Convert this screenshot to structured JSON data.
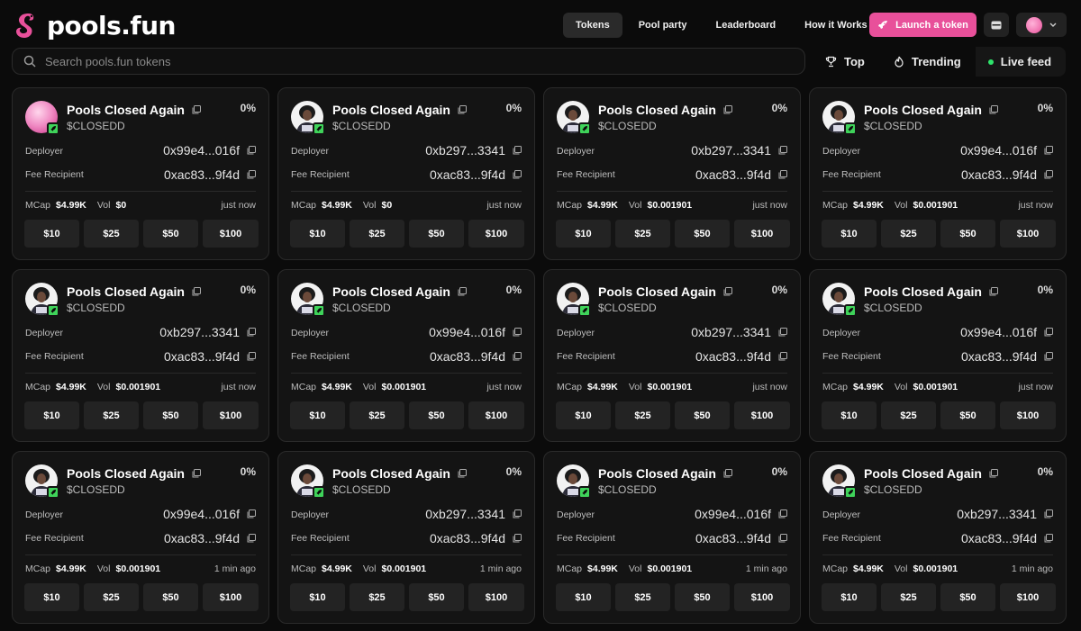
{
  "brand": {
    "name": "pools.fun"
  },
  "nav": {
    "items": [
      {
        "label": "Tokens",
        "active": true
      },
      {
        "label": "Pool party",
        "active": false
      },
      {
        "label": "Leaderboard",
        "active": false
      },
      {
        "label": "How it Works",
        "active": false
      }
    ],
    "launch_label": "Launch a token"
  },
  "search": {
    "placeholder": "Search pools.fun tokens"
  },
  "filters": [
    {
      "label": "Top",
      "icon": "trophy-icon"
    },
    {
      "label": "Trending",
      "icon": "flame-icon"
    },
    {
      "label": "Live feed",
      "icon": "live-dot-icon"
    }
  ],
  "colors": {
    "accent": "#e8509a",
    "live": "#2ee36b",
    "badge": "#3fd35a"
  },
  "labels": {
    "deployer": "Deployer",
    "fee_recipient": "Fee Recipient",
    "mcap": "MCap",
    "vol": "Vol"
  },
  "amounts": [
    "$10",
    "$25",
    "$50",
    "$100"
  ],
  "cards": [
    {
      "name": "Pools Closed Again",
      "ticker": "$CLOSEDD",
      "pct": "0%",
      "deployer": "0x99e4...016f",
      "fee": "0xac83...9f4d",
      "mcap": "$4.99K",
      "vol": "$0",
      "time": "just now",
      "avatar": "pink"
    },
    {
      "name": "Pools Closed Again",
      "ticker": "$CLOSEDD",
      "pct": "0%",
      "deployer": "0xb297...3341",
      "fee": "0xac83...9f4d",
      "mcap": "$4.99K",
      "vol": "$0",
      "time": "just now",
      "avatar": "person"
    },
    {
      "name": "Pools Closed Again",
      "ticker": "$CLOSEDD",
      "pct": "0%",
      "deployer": "0xb297...3341",
      "fee": "0xac83...9f4d",
      "mcap": "$4.99K",
      "vol": "$0.001901",
      "time": "just now",
      "avatar": "person"
    },
    {
      "name": "Pools Closed Again",
      "ticker": "$CLOSEDD",
      "pct": "0%",
      "deployer": "0x99e4...016f",
      "fee": "0xac83...9f4d",
      "mcap": "$4.99K",
      "vol": "$0.001901",
      "time": "just now",
      "avatar": "person"
    },
    {
      "name": "Pools Closed Again",
      "ticker": "$CLOSEDD",
      "pct": "0%",
      "deployer": "0xb297...3341",
      "fee": "0xac83...9f4d",
      "mcap": "$4.99K",
      "vol": "$0.001901",
      "time": "just now",
      "avatar": "person"
    },
    {
      "name": "Pools Closed Again",
      "ticker": "$CLOSEDD",
      "pct": "0%",
      "deployer": "0x99e4...016f",
      "fee": "0xac83...9f4d",
      "mcap": "$4.99K",
      "vol": "$0.001901",
      "time": "just now",
      "avatar": "person"
    },
    {
      "name": "Pools Closed Again",
      "ticker": "$CLOSEDD",
      "pct": "0%",
      "deployer": "0xb297...3341",
      "fee": "0xac83...9f4d",
      "mcap": "$4.99K",
      "vol": "$0.001901",
      "time": "just now",
      "avatar": "person"
    },
    {
      "name": "Pools Closed Again",
      "ticker": "$CLOSEDD",
      "pct": "0%",
      "deployer": "0x99e4...016f",
      "fee": "0xac83...9f4d",
      "mcap": "$4.99K",
      "vol": "$0.001901",
      "time": "just now",
      "avatar": "person"
    },
    {
      "name": "Pools Closed Again",
      "ticker": "$CLOSEDD",
      "pct": "0%",
      "deployer": "0x99e4...016f",
      "fee": "0xac83...9f4d",
      "mcap": "$4.99K",
      "vol": "$0.001901",
      "time": "1 min ago",
      "avatar": "person"
    },
    {
      "name": "Pools Closed Again",
      "ticker": "$CLOSEDD",
      "pct": "0%",
      "deployer": "0xb297...3341",
      "fee": "0xac83...9f4d",
      "mcap": "$4.99K",
      "vol": "$0.001901",
      "time": "1 min ago",
      "avatar": "person"
    },
    {
      "name": "Pools Closed Again",
      "ticker": "$CLOSEDD",
      "pct": "0%",
      "deployer": "0x99e4...016f",
      "fee": "0xac83...9f4d",
      "mcap": "$4.99K",
      "vol": "$0.001901",
      "time": "1 min ago",
      "avatar": "person"
    },
    {
      "name": "Pools Closed Again",
      "ticker": "$CLOSEDD",
      "pct": "0%",
      "deployer": "0xb297...3341",
      "fee": "0xac83...9f4d",
      "mcap": "$4.99K",
      "vol": "$0.001901",
      "time": "1 min ago",
      "avatar": "person"
    }
  ]
}
